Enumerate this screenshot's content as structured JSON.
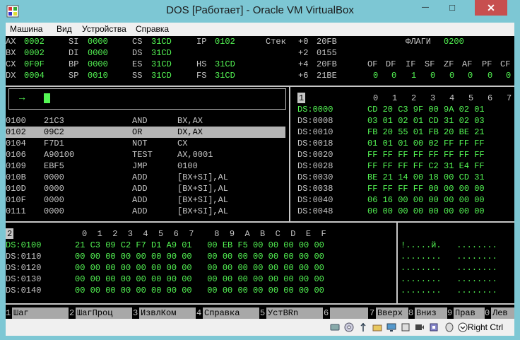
{
  "window": {
    "title": "DOS [Работает] - Oracle VM VirtualBox",
    "min_label": "—",
    "max_label": "□",
    "close_label": "✕"
  },
  "menu": [
    "Машина",
    "Вид",
    "Устройства",
    "Справка"
  ],
  "registers": [
    {
      "name": "AX",
      "value": "0002"
    },
    {
      "name": "BX",
      "value": "0002"
    },
    {
      "name": "CX",
      "value": "0F0F"
    },
    {
      "name": "DX",
      "value": "0004"
    },
    {
      "name": "SI",
      "value": "0000"
    },
    {
      "name": "DI",
      "value": "0000"
    },
    {
      "name": "BP",
      "value": "0000"
    },
    {
      "name": "SP",
      "value": "0010"
    },
    {
      "name": "CS",
      "value": "31CD"
    },
    {
      "name": "DS",
      "value": "31CD"
    },
    {
      "name": "ES",
      "value": "31CD"
    },
    {
      "name": "SS",
      "value": "31CD"
    },
    {
      "name": "IP",
      "value": "0102"
    },
    {
      "name": "HS",
      "value": "31CD"
    },
    {
      "name": "FS",
      "value": "31CD"
    }
  ],
  "stack": {
    "label": "Стек",
    "rows": [
      {
        "offset": "+0",
        "value": "20FB"
      },
      {
        "offset": "+2",
        "value": "0155"
      },
      {
        "offset": "+4",
        "value": "20FB"
      },
      {
        "offset": "+6",
        "value": "21BE"
      }
    ]
  },
  "flags": {
    "label": "ФЛАГИ",
    "value": "0200",
    "names": [
      "OF",
      "DF",
      "IF",
      "SF",
      "ZF",
      "AF",
      "PF",
      "CF"
    ],
    "values": [
      "0",
      "0",
      "1",
      "0",
      "0",
      "0",
      "0",
      "0"
    ]
  },
  "command_prompt": "→",
  "disassembly": [
    {
      "addr": "0100",
      "bytes": "21C3",
      "mnemonic": "AND",
      "operands": "BX,AX"
    },
    {
      "addr": "0102",
      "bytes": "09C2",
      "mnemonic": "OR",
      "operands": "DX,AX"
    },
    {
      "addr": "0104",
      "bytes": "F7D1",
      "mnemonic": "NOT",
      "operands": "CX"
    },
    {
      "addr": "0106",
      "bytes": "A90100",
      "mnemonic": "TEST",
      "operands": "AX,0001"
    },
    {
      "addr": "0109",
      "bytes": "EBF5",
      "mnemonic": "JMP",
      "operands": "0100"
    },
    {
      "addr": "010B",
      "bytes": "0000",
      "mnemonic": "ADD",
      "operands": "[BX+SI],AL"
    },
    {
      "addr": "010D",
      "bytes": "0000",
      "mnemonic": "ADD",
      "operands": "[BX+SI],AL"
    },
    {
      "addr": "010F",
      "bytes": "0000",
      "mnemonic": "ADD",
      "operands": "[BX+SI],AL"
    },
    {
      "addr": "0111",
      "bytes": "0000",
      "mnemonic": "ADD",
      "operands": "[BX+SI],AL"
    }
  ],
  "dump1": {
    "pane_number": "1",
    "columns": [
      "0",
      "1",
      "2",
      "3",
      "4",
      "5",
      "6",
      "7"
    ],
    "rows": [
      {
        "addr": "DS:0000",
        "bytes": "CD 20 C3 9F 00 9A 02 01"
      },
      {
        "addr": "DS:0008",
        "bytes": "03 01 02 01 CD 31 02 03"
      },
      {
        "addr": "DS:0010",
        "bytes": "FB 20 55 01 FB 20 BE 21"
      },
      {
        "addr": "DS:0018",
        "bytes": "01 01 01 00 02 FF FF FF"
      },
      {
        "addr": "DS:0020",
        "bytes": "FF FF FF FF FF FF FF FF"
      },
      {
        "addr": "DS:0028",
        "bytes": "FF FF FF FF C2 31 E4 FF"
      },
      {
        "addr": "DS:0030",
        "bytes": "BE 21 14 00 18 00 CD 31"
      },
      {
        "addr": "DS:0038",
        "bytes": "FF FF FF FF 00 00 00 00"
      },
      {
        "addr": "DS:0040",
        "bytes": "06 16 00 00 00 00 00 00"
      },
      {
        "addr": "DS:0048",
        "bytes": "00 00 00 00 00 00 00 00"
      }
    ]
  },
  "dump2": {
    "pane_number": "2",
    "columns": "0  1  2  3  4  5  6  7    8  9  A  B  C  D  E  F",
    "rows": [
      {
        "addr": "DS:0100",
        "bytes": "21 C3 09 C2 F7 D1 A9 01   00 EB F5 00 00 00 00 00",
        "ascii": "!.....й.   ........"
      },
      {
        "addr": "DS:0110",
        "bytes": "00 00 00 00 00 00 00 00   00 00 00 00 00 00 00 00",
        "ascii": "........   ........"
      },
      {
        "addr": "DS:0120",
        "bytes": "00 00 00 00 00 00 00 00   00 00 00 00 00 00 00 00",
        "ascii": "........   ........"
      },
      {
        "addr": "DS:0130",
        "bytes": "00 00 00 00 00 00 00 00   00 00 00 00 00 00 00 00",
        "ascii": "........   ........"
      },
      {
        "addr": "DS:0140",
        "bytes": "00 00 00 00 00 00 00 00   00 00 00 00 00 00 00 00",
        "ascii": "........   ........"
      }
    ]
  },
  "function_keys": [
    {
      "num": "1",
      "label": "Шаг"
    },
    {
      "num": "2",
      "label": "ШагПроц"
    },
    {
      "num": "3",
      "label": "ИзвлКом"
    },
    {
      "num": "4",
      "label": "Справка"
    },
    {
      "num": "5",
      "label": "УстBRn"
    },
    {
      "num": "6",
      "label": ""
    },
    {
      "num": "7",
      "label": "Вверх"
    },
    {
      "num": "8",
      "label": "Вниз"
    },
    {
      "num": "9",
      "label": "Прав"
    },
    {
      "num": "0",
      "label": "Лев"
    }
  ],
  "statusbar": {
    "host_key": "Right Ctrl",
    "icons": [
      "hard-disk-icon",
      "optical-drive-icon",
      "usb-icon",
      "shared-folders-icon",
      "display-icon",
      "network-icon",
      "recording-icon",
      "cpu-icon",
      "mouse-integration-icon",
      "keyboard-icon"
    ]
  }
}
